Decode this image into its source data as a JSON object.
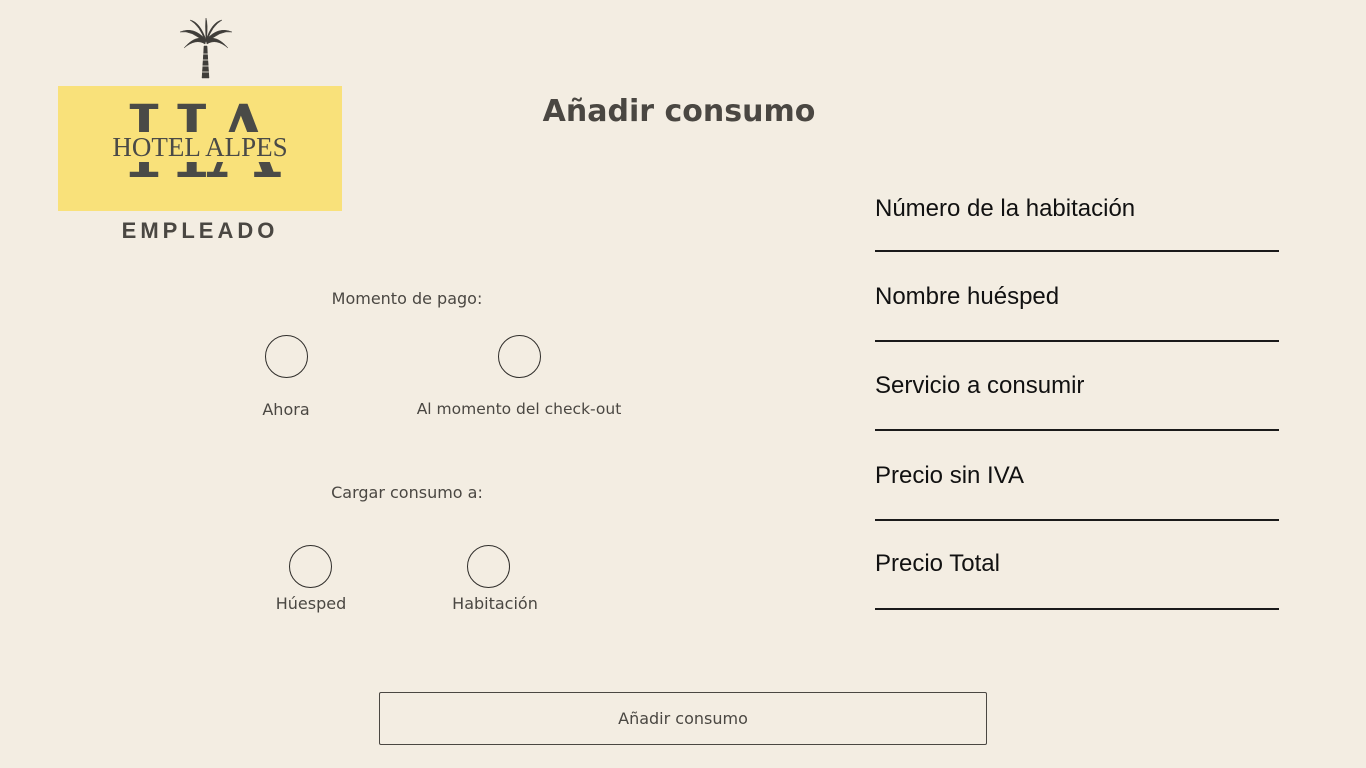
{
  "logo": {
    "monogram": "HA",
    "hotel_name": "HOTEL ALPES",
    "role": "EMPLEADO",
    "icon": "palm-tree-icon",
    "background_color": "#f9e17a"
  },
  "page_title": "Añadir consumo",
  "payment_moment": {
    "label": "Momento de pago:",
    "options": [
      {
        "label": "Ahora"
      },
      {
        "label": "Al momento del check-out"
      }
    ]
  },
  "charge_to": {
    "label": "Cargar consumo a:",
    "options": [
      {
        "label": "Húesped"
      },
      {
        "label": "Habitación"
      }
    ]
  },
  "fields": [
    {
      "label": "Número de la habitación"
    },
    {
      "label": "Nombre huésped"
    },
    {
      "label": "Servicio a consumir"
    },
    {
      "label": "Precio sin IVA"
    },
    {
      "label": "Precio Total"
    }
  ],
  "submit_button": "Añadir consumo",
  "colors": {
    "background": "#f3ede2",
    "text": "#4a4742"
  }
}
